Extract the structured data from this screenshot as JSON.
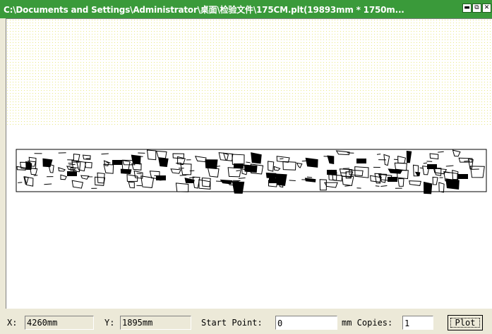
{
  "window": {
    "title": "C:\\Documents and Settings\\Administrator\\桌面\\检验文件\\175CM.plt(19893mm * 1750m..."
  },
  "titlebar_buttons": [
    {
      "name": "minimize-button",
      "icon": "minimize-icon",
      "glyph": "▬"
    },
    {
      "name": "maximize-button",
      "icon": "maximize-icon",
      "glyph": "⧉"
    },
    {
      "name": "close-button",
      "icon": "close-icon",
      "glyph": "✕"
    }
  ],
  "status": {
    "x_label": "X:",
    "x_value": "4260mm",
    "y_label": "Y:",
    "y_value": "1895mm",
    "start_point_label": "Start Point:",
    "start_point_value": "0",
    "unit_copies_label": "mm Copies:",
    "copies_value": "1",
    "plot_label": "Plot"
  },
  "colors": {
    "titlebar": "#3a9a3a",
    "dot_grid": "#e8e880",
    "canvas": "#ffffff",
    "marker_pattern": "#000000"
  }
}
